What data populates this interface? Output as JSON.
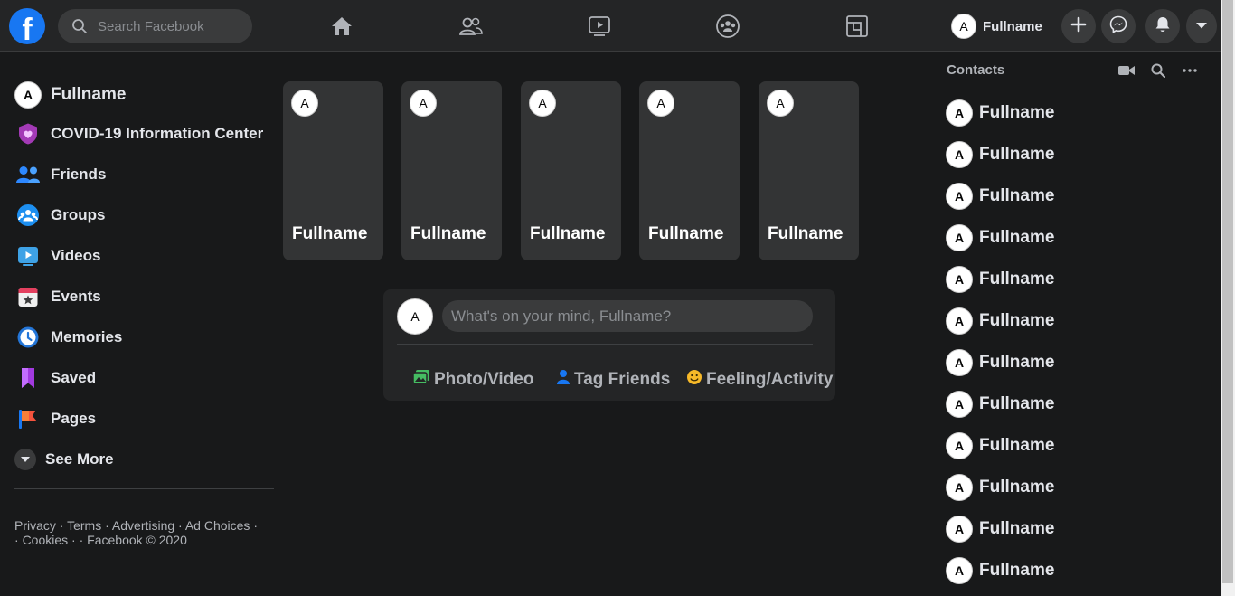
{
  "header": {
    "logo_letter": "f",
    "search_placeholder": "Search Facebook",
    "nav": [
      "home-icon",
      "friends-icon",
      "watch-icon",
      "groups-icon",
      "gaming-icon"
    ],
    "profile_initial": "A",
    "profile_name": "Fullname",
    "actions": [
      "create-icon",
      "messenger-icon",
      "notifications-icon",
      "account-menu-icon"
    ]
  },
  "sidebar": {
    "profile_initial": "A",
    "profile_name": "Fullname",
    "items": [
      {
        "label": "COVID-19 Information Center",
        "icon": "covid-info-icon"
      },
      {
        "label": "Friends",
        "icon": "friends-icon"
      },
      {
        "label": "Groups",
        "icon": "groups-icon"
      },
      {
        "label": "Videos",
        "icon": "videos-icon"
      },
      {
        "label": "Events",
        "icon": "events-icon"
      },
      {
        "label": "Memories",
        "icon": "memories-icon"
      },
      {
        "label": "Saved",
        "icon": "saved-icon"
      },
      {
        "label": "Pages",
        "icon": "pages-icon"
      }
    ],
    "see_more": "See More",
    "footer": {
      "links": [
        "Privacy",
        "Terms",
        "Advertising",
        "Ad Choices",
        "Cookies"
      ],
      "copyright": "Facebook © 2020"
    }
  },
  "stories": [
    {
      "initial": "A",
      "name": "Fullname"
    },
    {
      "initial": "A",
      "name": "Fullname"
    },
    {
      "initial": "A",
      "name": "Fullname"
    },
    {
      "initial": "A",
      "name": "Fullname"
    },
    {
      "initial": "A",
      "name": "Fullname"
    }
  ],
  "composer": {
    "initial": "A",
    "placeholder": "What's on your mind, Fullname?",
    "actions": {
      "photo": "Photo/Video",
      "tag": "Tag Friends",
      "feeling": "Feeling/Activity"
    }
  },
  "contacts": {
    "title": "Contacts",
    "tools": [
      "video-call-icon",
      "search-icon",
      "more-options-icon"
    ],
    "list": [
      {
        "initial": "A",
        "name": "Fullname"
      },
      {
        "initial": "A",
        "name": "Fullname"
      },
      {
        "initial": "A",
        "name": "Fullname"
      },
      {
        "initial": "A",
        "name": "Fullname"
      },
      {
        "initial": "A",
        "name": "Fullname"
      },
      {
        "initial": "A",
        "name": "Fullname"
      },
      {
        "initial": "A",
        "name": "Fullname"
      },
      {
        "initial": "A",
        "name": "Fullname"
      },
      {
        "initial": "A",
        "name": "Fullname"
      },
      {
        "initial": "A",
        "name": "Fullname"
      },
      {
        "initial": "A",
        "name": "Fullname"
      },
      {
        "initial": "A",
        "name": "Fullname"
      }
    ]
  },
  "colors": {
    "background": "#18191a",
    "surface": "#242526",
    "brand": "#1877f2"
  }
}
